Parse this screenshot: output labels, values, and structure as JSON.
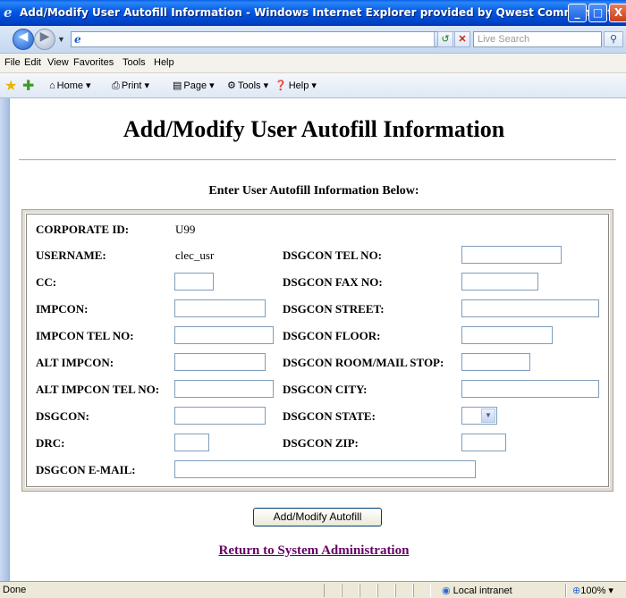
{
  "window": {
    "title": "Add/Modify User Autofill Information - Windows Internet Explorer provided by Qwest Communications",
    "controls": {
      "minimize": "_",
      "maximize": "□",
      "close": "X"
    }
  },
  "address_bar": {
    "url": "",
    "search_placeholder": "Live Search"
  },
  "menu": [
    "File",
    "Edit",
    "View",
    "Favorites",
    "Tools",
    "Help"
  ],
  "command_bar": {
    "home": "Home",
    "print": "Print",
    "page": "Page",
    "tools": "Tools",
    "help": "Help"
  },
  "page": {
    "title": "Add/Modify User Autofill Information",
    "subheading": "Enter User Autofill Information Below:",
    "form": {
      "corporate_id_label": "CORPORATE ID:",
      "corporate_id_value": "U99",
      "username_label": "USERNAME:",
      "username_value": "clec_usr",
      "cc_label": "CC:",
      "impcon_label": "IMPCON:",
      "impcon_tel_label": "IMPCON TEL NO:",
      "alt_impcon_label": "ALT IMPCON:",
      "alt_impcon_tel_label": "ALT IMPCON TEL NO:",
      "dsgcon_label": "DSGCON:",
      "drc_label": "DRC:",
      "dsgcon_email_label": "DSGCON E-MAIL:",
      "dsgcon_tel_label": "DSGCON TEL NO:",
      "dsgcon_fax_label": "DSGCON FAX NO:",
      "dsgcon_street_label": "DSGCON STREET:",
      "dsgcon_floor_label": "DSGCON FLOOR:",
      "dsgcon_room_label": "DSGCON ROOM/MAIL STOP:",
      "dsgcon_city_label": "DSGCON CITY:",
      "dsgcon_state_label": "DSGCON STATE:",
      "dsgcon_zip_label": "DSGCON ZIP:",
      "dsgcon_state_value": ""
    },
    "submit_label": "Add/Modify Autofill",
    "return_link": "Return to System Administration"
  },
  "status_bar": {
    "status": "Done",
    "zone": "Local intranet",
    "zoom": "100%"
  },
  "colors": {
    "title_bar": "#0058e6",
    "visited_link": "#660066"
  }
}
